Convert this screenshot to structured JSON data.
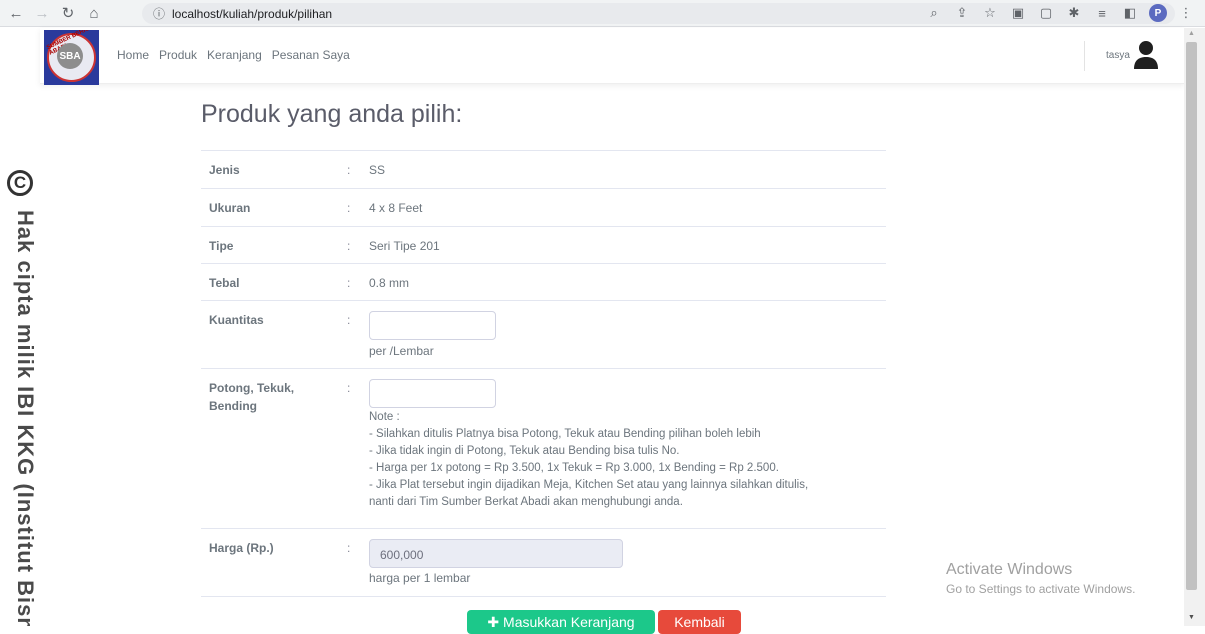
{
  "browser": {
    "url": "localhost/kuliah/produk/pilihan",
    "profile_initial": "P"
  },
  "watermark": {
    "circle_letter": "C",
    "text": "Hak cipta milik IBI KKG (Institut Bisnis"
  },
  "navbar": {
    "logo_text": "SBA",
    "logo_ring_text": "SUMBER BERKAT ABADI",
    "links": [
      "Home",
      "Produk",
      "Keranjang",
      "Pesanan Saya"
    ],
    "username": "tasya"
  },
  "page": {
    "title": "Produk yang anda pilih:",
    "rows": [
      {
        "label": "Jenis",
        "value": "SS"
      },
      {
        "label": "Ukuran",
        "value": "4 x 8 Feet"
      },
      {
        "label": "Tipe",
        "value": "Seri Tipe 201"
      },
      {
        "label": "Tebal",
        "value": "0.8 mm"
      }
    ],
    "kuantitas": {
      "label": "Kuantitas",
      "value": "",
      "hint": "per /Lembar"
    },
    "potong": {
      "label_line1": "Potong, Tekuk,",
      "label_line2": "Bending",
      "value": "",
      "note_lines": [
        "Note :",
        "- Silahkan ditulis Platnya bisa Potong, Tekuk atau Bending pilihan boleh lebih",
        "- Jika tidak ingin di Potong, Tekuk atau Bending bisa tulis No.",
        "- Harga per 1x potong = Rp 3.500, 1x Tekuk = Rp 3.000, 1x Bending = Rp 2.500.",
        "- Jika Plat tersebut ingin dijadikan Meja, Kitchen Set atau yang lainnya silahkan ditulis,",
        "nanti dari Tim Sumber Berkat Abadi akan menghubungi anda."
      ]
    },
    "harga": {
      "label": "Harga (Rp.)",
      "value": "600,000",
      "hint": "harga per 1 lembar"
    },
    "colon": ":",
    "buttons": {
      "add_to_cart": "✚ Masukkan Keranjang",
      "back": "Kembali"
    }
  },
  "os_overlay": {
    "line1": "Activate Windows",
    "line2": "Go to Settings to activate Windows."
  },
  "colors": {
    "success": "#1cc88a",
    "danger": "#e74a3b",
    "text_muted": "#6c757d"
  }
}
